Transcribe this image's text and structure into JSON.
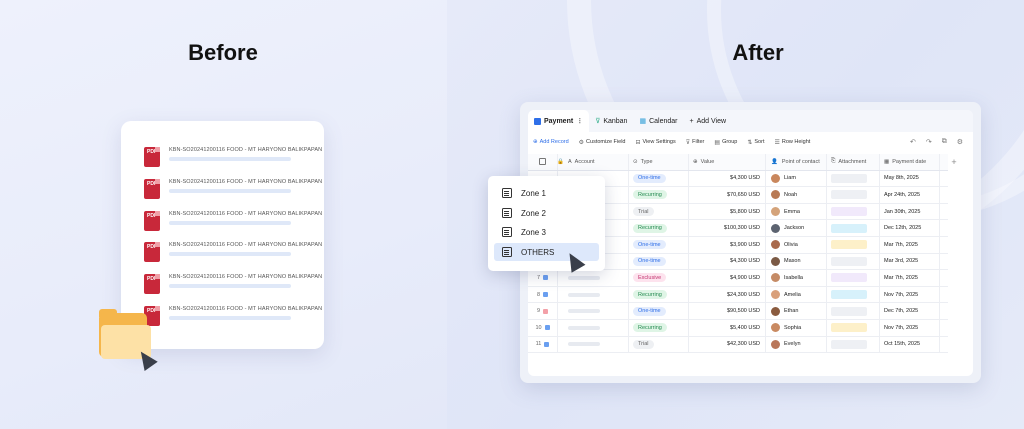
{
  "headings": {
    "before": "Before",
    "after": "After"
  },
  "files": [
    {
      "name": "KBN-SO20241200116 FOOD - MT HARYONO BALIKPAPAN",
      "icon_text": "PDF"
    },
    {
      "name": "KBN-SO20241200116 FOOD - MT HARYONO BALIKPAPAN",
      "icon_text": "PDF"
    },
    {
      "name": "KBN-SO20241200116 FOOD - MT HARYONO BALIKPAPAN",
      "icon_text": "PDF"
    },
    {
      "name": "KBN-SO20241200116 FOOD - MT HARYONO BALIKPAPAN",
      "icon_text": "PDF"
    },
    {
      "name": "KBN-SO20241200116 FOOD - MT HARYONO BALIKPAPAN",
      "icon_text": "PDF"
    },
    {
      "name": "KBN-SO20241200116 FOOD - MT HARYONO BALIKPAPAN",
      "icon_text": "PDF"
    }
  ],
  "tabs": [
    {
      "label": "Payment",
      "icon_color": "#2f6fe8"
    },
    {
      "label": "Kanban",
      "icon_color": "#2fae8a"
    },
    {
      "label": "Calendar",
      "icon_color": "#2f9fd8"
    },
    {
      "label": "Add View",
      "icon_color": "#333333"
    }
  ],
  "toolbar": {
    "add_record": "Add Record",
    "customize_field": "Customize Field",
    "view_settings": "View Settings",
    "filter": "Filter",
    "group": "Group",
    "sort": "Sort",
    "row_height": "Row Height"
  },
  "columns": {
    "account": "Account",
    "type": "Type",
    "value": "Value",
    "poc": "Point of contact",
    "attachment": "Attachment",
    "payment_date": "Payment date"
  },
  "rows": [
    {
      "num": "",
      "dot": "",
      "type": "One-time",
      "value": "$4,300 USD",
      "poc": "Liam",
      "avatar": "#c9875d",
      "att": "#eef0f4",
      "date": "May 8th, 2025"
    },
    {
      "num": "",
      "dot": "",
      "type": "Recurring",
      "value": "$70,650 USD",
      "poc": "Noah",
      "avatar": "#b87a55",
      "att": "#eef0f4",
      "date": "Apr 24th, 2025"
    },
    {
      "num": "",
      "dot": "",
      "type": "Trial",
      "value": "$5,800 USD",
      "poc": "Emma",
      "avatar": "#d4a37a",
      "att": "#f1e9fb",
      "date": "Jan 30th, 2025"
    },
    {
      "num": "",
      "dot": "",
      "type": "Recurring",
      "value": "$100,300 USD",
      "poc": "Jackson",
      "avatar": "#5c6370",
      "att": "#d7f1fb",
      "date": "Dec 12th, 2025"
    },
    {
      "num": "",
      "dot": "",
      "type": "One-time",
      "value": "$3,900 USD",
      "poc": "Olivia",
      "avatar": "#a96a4c",
      "att": "#fdf0c9",
      "date": "Mar 7th, 2025"
    },
    {
      "num": "",
      "dot": "",
      "type": "One-time",
      "value": "$4,300 USD",
      "poc": "Mason",
      "avatar": "#7b5a45",
      "att": "#eef0f4",
      "date": "Mar 3rd, 2025"
    },
    {
      "num": "7",
      "dot": "#6a9ff0",
      "type": "Exclusive",
      "value": "$4,900 USD",
      "poc": "Isabella",
      "avatar": "#c58b66",
      "att": "#f1e9fb",
      "date": "Mar 7th, 2025"
    },
    {
      "num": "8",
      "dot": "#6a9ff0",
      "type": "Recurring",
      "value": "$24,300 USD",
      "poc": "Amelia",
      "avatar": "#d9a07b",
      "att": "#d7f1fb",
      "date": "Nov 7th, 2025"
    },
    {
      "num": "9",
      "dot": "#f3a0a8",
      "type": "One-time",
      "value": "$90,500 USD",
      "poc": "Ethan",
      "avatar": "#8a5b3f",
      "att": "#eef0f4",
      "date": "Dec 7th, 2025"
    },
    {
      "num": "10",
      "dot": "#6a9ff0",
      "type": "Recurring",
      "value": "$5,400 USD",
      "poc": "Sophia",
      "avatar": "#c98a62",
      "att": "#fdf0c9",
      "date": "Nov 7th, 2025"
    },
    {
      "num": "11",
      "dot": "#6a9ff0",
      "type": "Trial",
      "value": "$42,300 USD",
      "poc": "Evelyn",
      "avatar": "#b9775a",
      "att": "#eef0f4",
      "date": "Oct 15th, 2025"
    }
  ],
  "type_styles": {
    "One-time": {
      "bg": "#e3ecfd",
      "fg": "#2f6fe8"
    },
    "Recurring": {
      "bg": "#dff5e6",
      "fg": "#238a4f"
    },
    "Trial": {
      "bg": "#eef0f3",
      "fg": "#666666"
    },
    "Exclusive": {
      "bg": "#fde3ee",
      "fg": "#c2336e"
    }
  },
  "dropdown": {
    "items": [
      {
        "label": "Zone 1",
        "selected": false
      },
      {
        "label": "Zone 2",
        "selected": false
      },
      {
        "label": "Zone 3",
        "selected": false
      },
      {
        "label": "OTHERS",
        "selected": true
      }
    ]
  }
}
